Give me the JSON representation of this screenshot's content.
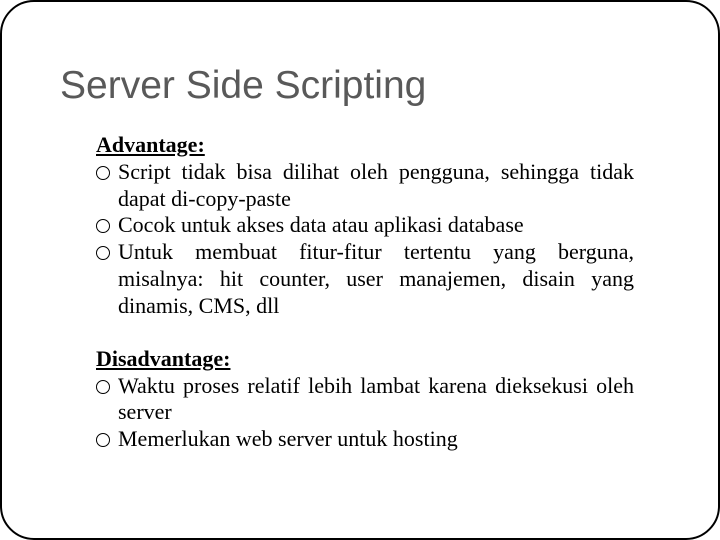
{
  "title": "Server Side Scripting",
  "sections": {
    "advantage": {
      "heading": "Advantage:",
      "items": [
        "Script tidak bisa dilihat oleh pengguna, sehingga tidak dapat di-copy-paste",
        "Cocok untuk akses data atau aplikasi database",
        "Untuk membuat fitur-fitur tertentu yang berguna, misalnya: hit counter, user manajemen, disain yang dinamis, CMS, dll"
      ]
    },
    "disadvantage": {
      "heading": "Disadvantage:",
      "items": [
        "Waktu proses relatif lebih lambat karena dieksekusi oleh server",
        "Memerlukan web server untuk hosting"
      ]
    }
  }
}
